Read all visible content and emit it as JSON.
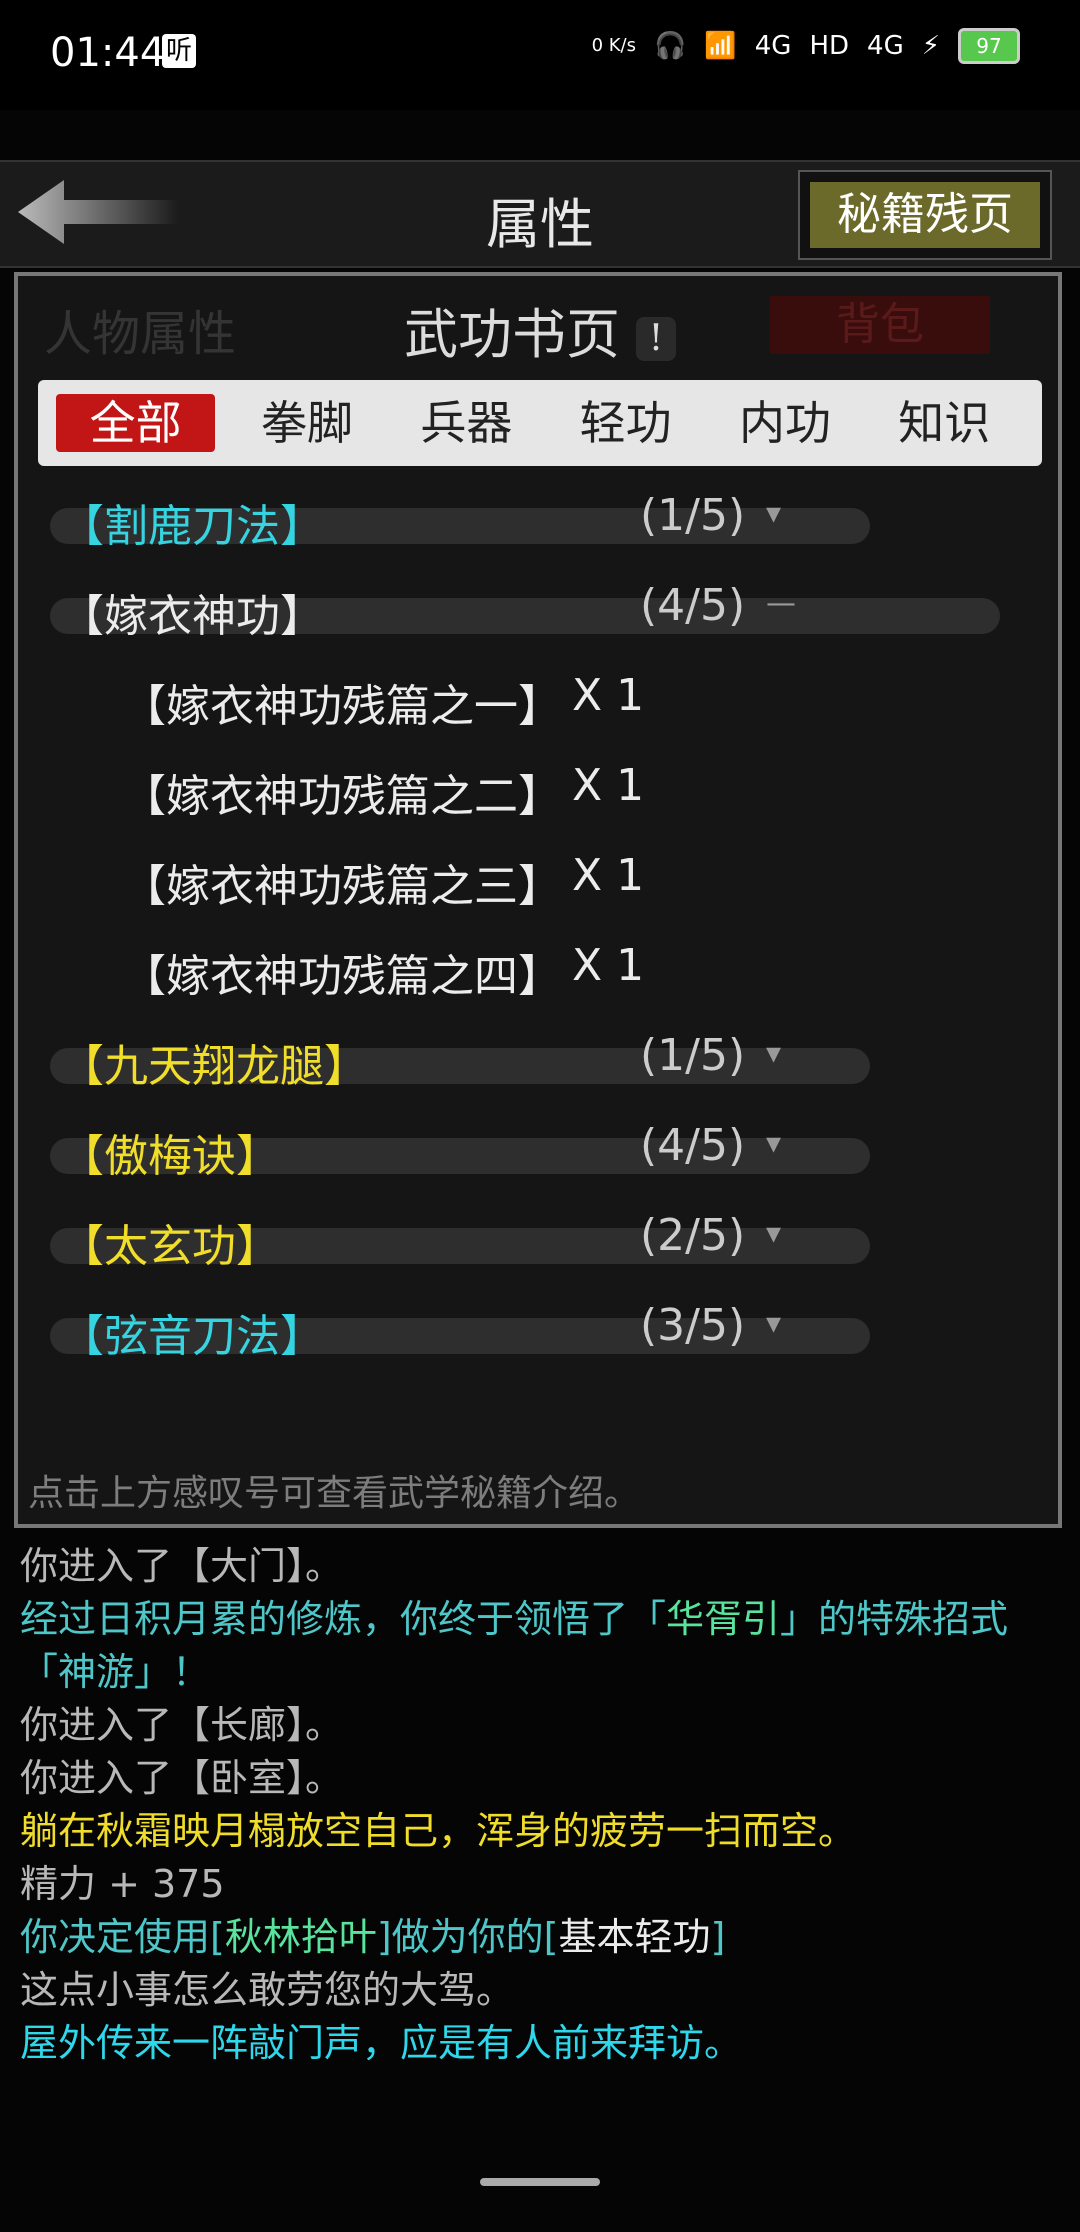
{
  "status": {
    "time": "01:44",
    "badge": "听",
    "icons": [
      "speed-icon",
      "headphone-icon",
      "wifi-icon",
      "signal-4g-icon",
      "hd-icon",
      "signal-4g-icon",
      "charging-icon"
    ],
    "speed": "0 K/s",
    "net1": "4G",
    "hd": "HD",
    "net2": "4G",
    "battery": "97"
  },
  "header": {
    "title": "属性",
    "cheat_button": "秘籍残页"
  },
  "dialog": {
    "title": "武功书页",
    "info_mark": "!",
    "ghost_left": "人物属性",
    "ghost_right": "背包",
    "tabs": [
      "全部",
      "拳脚",
      "兵器",
      "轻功",
      "内功",
      "知识"
    ],
    "active_tab": "全部",
    "items": [
      {
        "name": "【割鹿刀法】",
        "progress": "(1/5)",
        "toggle": "▾",
        "color": "cyan"
      },
      {
        "name": "【嫁衣神功】",
        "progress": "(4/5)",
        "toggle": "—",
        "color": "white",
        "expanded": true,
        "pages": [
          {
            "name": "【嫁衣神功残篇之一】",
            "qty": "X 1"
          },
          {
            "name": "【嫁衣神功残篇之二】",
            "qty": "X 1"
          },
          {
            "name": "【嫁衣神功残篇之三】",
            "qty": "X 1"
          },
          {
            "name": "【嫁衣神功残篇之四】",
            "qty": "X 1"
          }
        ]
      },
      {
        "name": "【九天翔龙腿】",
        "progress": "(1/5)",
        "toggle": "▾",
        "color": "yellow"
      },
      {
        "name": "【傲梅诀】",
        "progress": "(4/5)",
        "toggle": "▾",
        "color": "yellow"
      },
      {
        "name": "【太玄功】",
        "progress": "(2/5)",
        "toggle": "▾",
        "color": "yellow"
      },
      {
        "name": "【弦音刀法】",
        "progress": "(3/5)",
        "toggle": "▾",
        "color": "cyan"
      }
    ],
    "hint": "点击上方感叹号可查看武学秘籍介绍。"
  },
  "log": {
    "l1": "你进入了【大门】。",
    "l2a": "经过日积月累的修炼，你终于领悟了「",
    "l2b": "华胥引",
    "l2c": "」的特殊招式「神游」！",
    "l3": "你进入了【长廊】。",
    "l4": "你进入了【卧室】。",
    "l5": "躺在秋霜映月榻放空自己，浑身的疲劳一扫而空。",
    "l6": "精力 + 375",
    "l7a": "你决定使用[",
    "l7b": "秋林拾叶",
    "l7c": "]做为你的[",
    "l7d": "基本轻功",
    "l7e": "]",
    "l8": "这点小事怎么敢劳您的大驾。",
    "l9": "屋外传来一阵敲门声，应是有人前来拜访。"
  }
}
